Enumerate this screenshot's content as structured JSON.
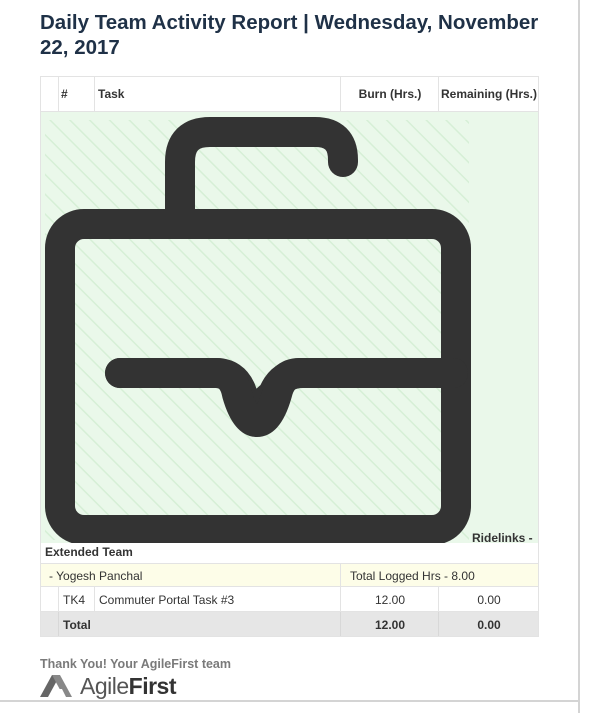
{
  "report": {
    "title": "Daily Team Activity Report | Wednesday, November 22, 2017"
  },
  "table": {
    "headers": {
      "num": "#",
      "task": "Task",
      "burn": "Burn (Hrs.)",
      "remaining": "Remaining (Hrs.)"
    },
    "project_label": "Ridelinks -",
    "team_label": "Extended Team",
    "member": {
      "name": "- Yogesh Panchal",
      "logged": "Total Logged Hrs - 8.00"
    },
    "tasks": [
      {
        "id": "TK4",
        "name": "Commuter Portal Task #3",
        "burn": "12.00",
        "remaining": "0.00"
      }
    ],
    "total": {
      "label": "Total",
      "burn": "12.00",
      "remaining": "0.00"
    }
  },
  "footer": {
    "thanks": "Thank You! Your AgileFirst team",
    "logo_light": "Agile",
    "logo_bold": "First"
  },
  "icons": {
    "illustration": "briefcase-icon",
    "logo_mark": "agilefirst-logo-icon"
  },
  "colors": {
    "title": "#1f3147",
    "illustration_bg": "#eaf8ea",
    "icon": "#333333",
    "member_row_bg": "#fdfde8",
    "total_row_bg": "#e6e6e6"
  }
}
